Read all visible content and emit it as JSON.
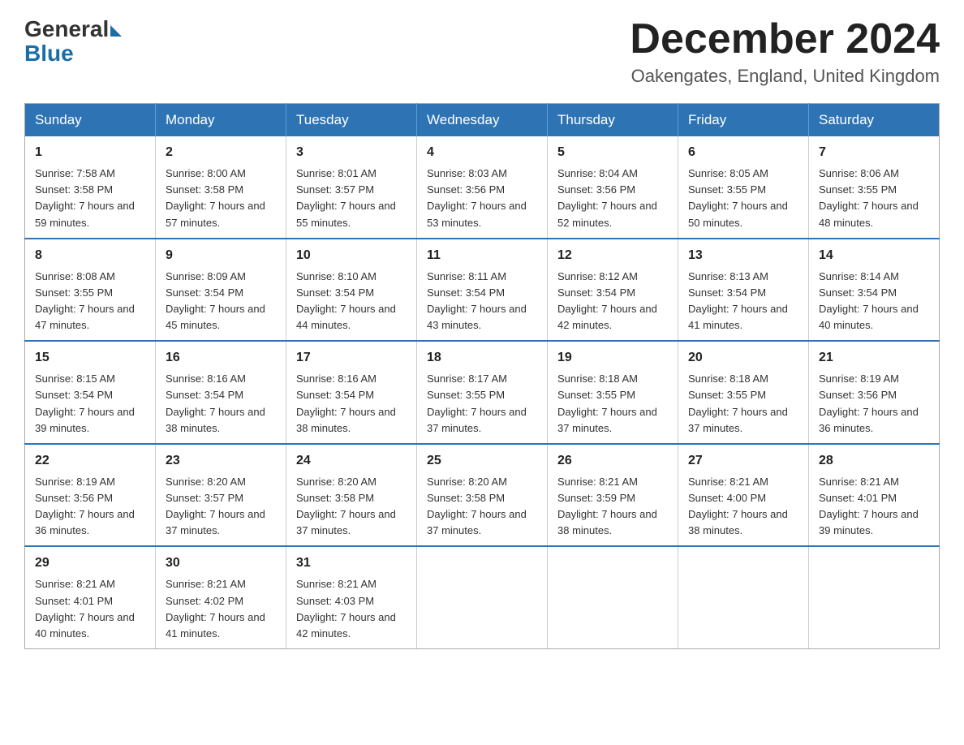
{
  "header": {
    "logo_general": "General",
    "logo_blue": "Blue",
    "month_title": "December 2024",
    "location": "Oakengates, England, United Kingdom"
  },
  "weekdays": [
    "Sunday",
    "Monday",
    "Tuesday",
    "Wednesday",
    "Thursday",
    "Friday",
    "Saturday"
  ],
  "weeks": [
    [
      {
        "day": "1",
        "sunrise": "7:58 AM",
        "sunset": "3:58 PM",
        "daylight": "7 hours and 59 minutes."
      },
      {
        "day": "2",
        "sunrise": "8:00 AM",
        "sunset": "3:58 PM",
        "daylight": "7 hours and 57 minutes."
      },
      {
        "day": "3",
        "sunrise": "8:01 AM",
        "sunset": "3:57 PM",
        "daylight": "7 hours and 55 minutes."
      },
      {
        "day": "4",
        "sunrise": "8:03 AM",
        "sunset": "3:56 PM",
        "daylight": "7 hours and 53 minutes."
      },
      {
        "day": "5",
        "sunrise": "8:04 AM",
        "sunset": "3:56 PM",
        "daylight": "7 hours and 52 minutes."
      },
      {
        "day": "6",
        "sunrise": "8:05 AM",
        "sunset": "3:55 PM",
        "daylight": "7 hours and 50 minutes."
      },
      {
        "day": "7",
        "sunrise": "8:06 AM",
        "sunset": "3:55 PM",
        "daylight": "7 hours and 48 minutes."
      }
    ],
    [
      {
        "day": "8",
        "sunrise": "8:08 AM",
        "sunset": "3:55 PM",
        "daylight": "7 hours and 47 minutes."
      },
      {
        "day": "9",
        "sunrise": "8:09 AM",
        "sunset": "3:54 PM",
        "daylight": "7 hours and 45 minutes."
      },
      {
        "day": "10",
        "sunrise": "8:10 AM",
        "sunset": "3:54 PM",
        "daylight": "7 hours and 44 minutes."
      },
      {
        "day": "11",
        "sunrise": "8:11 AM",
        "sunset": "3:54 PM",
        "daylight": "7 hours and 43 minutes."
      },
      {
        "day": "12",
        "sunrise": "8:12 AM",
        "sunset": "3:54 PM",
        "daylight": "7 hours and 42 minutes."
      },
      {
        "day": "13",
        "sunrise": "8:13 AM",
        "sunset": "3:54 PM",
        "daylight": "7 hours and 41 minutes."
      },
      {
        "day": "14",
        "sunrise": "8:14 AM",
        "sunset": "3:54 PM",
        "daylight": "7 hours and 40 minutes."
      }
    ],
    [
      {
        "day": "15",
        "sunrise": "8:15 AM",
        "sunset": "3:54 PM",
        "daylight": "7 hours and 39 minutes."
      },
      {
        "day": "16",
        "sunrise": "8:16 AM",
        "sunset": "3:54 PM",
        "daylight": "7 hours and 38 minutes."
      },
      {
        "day": "17",
        "sunrise": "8:16 AM",
        "sunset": "3:54 PM",
        "daylight": "7 hours and 38 minutes."
      },
      {
        "day": "18",
        "sunrise": "8:17 AM",
        "sunset": "3:55 PM",
        "daylight": "7 hours and 37 minutes."
      },
      {
        "day": "19",
        "sunrise": "8:18 AM",
        "sunset": "3:55 PM",
        "daylight": "7 hours and 37 minutes."
      },
      {
        "day": "20",
        "sunrise": "8:18 AM",
        "sunset": "3:55 PM",
        "daylight": "7 hours and 37 minutes."
      },
      {
        "day": "21",
        "sunrise": "8:19 AM",
        "sunset": "3:56 PM",
        "daylight": "7 hours and 36 minutes."
      }
    ],
    [
      {
        "day": "22",
        "sunrise": "8:19 AM",
        "sunset": "3:56 PM",
        "daylight": "7 hours and 36 minutes."
      },
      {
        "day": "23",
        "sunrise": "8:20 AM",
        "sunset": "3:57 PM",
        "daylight": "7 hours and 37 minutes."
      },
      {
        "day": "24",
        "sunrise": "8:20 AM",
        "sunset": "3:58 PM",
        "daylight": "7 hours and 37 minutes."
      },
      {
        "day": "25",
        "sunrise": "8:20 AM",
        "sunset": "3:58 PM",
        "daylight": "7 hours and 37 minutes."
      },
      {
        "day": "26",
        "sunrise": "8:21 AM",
        "sunset": "3:59 PM",
        "daylight": "7 hours and 38 minutes."
      },
      {
        "day": "27",
        "sunrise": "8:21 AM",
        "sunset": "4:00 PM",
        "daylight": "7 hours and 38 minutes."
      },
      {
        "day": "28",
        "sunrise": "8:21 AM",
        "sunset": "4:01 PM",
        "daylight": "7 hours and 39 minutes."
      }
    ],
    [
      {
        "day": "29",
        "sunrise": "8:21 AM",
        "sunset": "4:01 PM",
        "daylight": "7 hours and 40 minutes."
      },
      {
        "day": "30",
        "sunrise": "8:21 AM",
        "sunset": "4:02 PM",
        "daylight": "7 hours and 41 minutes."
      },
      {
        "day": "31",
        "sunrise": "8:21 AM",
        "sunset": "4:03 PM",
        "daylight": "7 hours and 42 minutes."
      },
      null,
      null,
      null,
      null
    ]
  ]
}
